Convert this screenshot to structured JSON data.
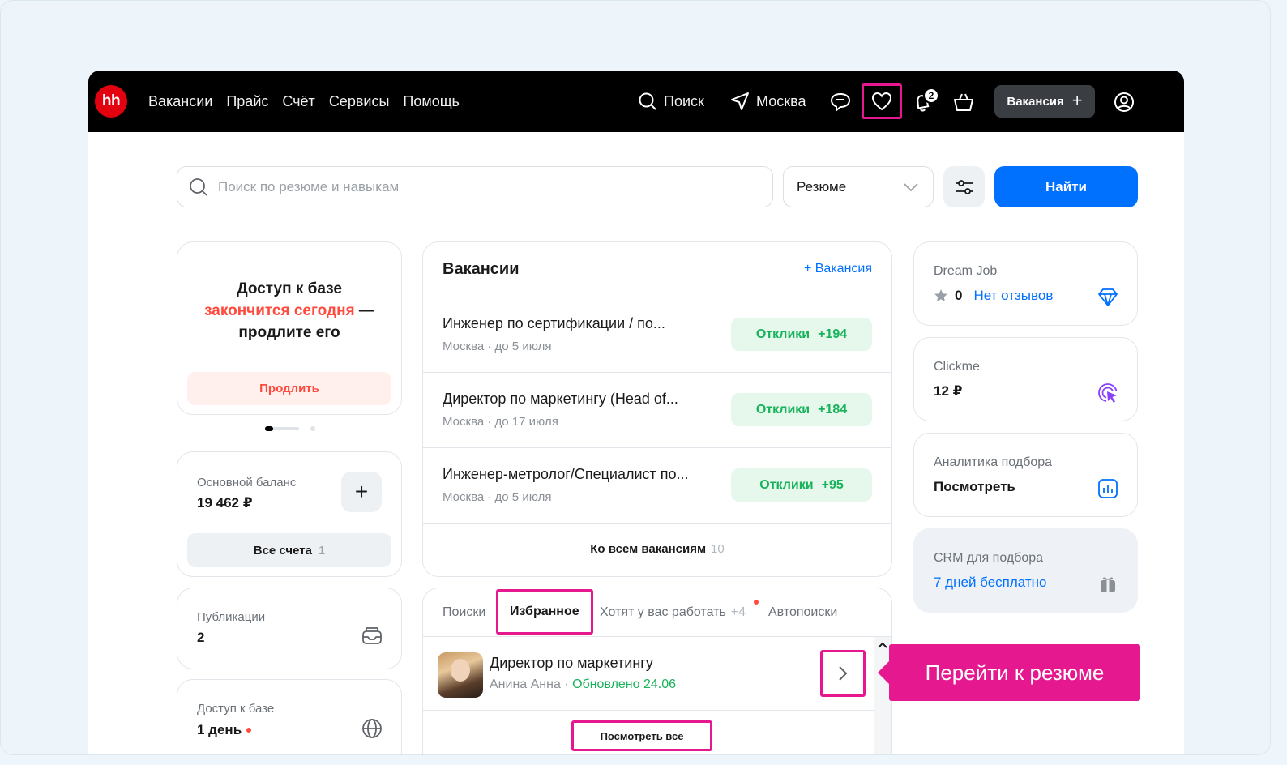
{
  "header": {
    "logo": "hh",
    "nav": [
      "Вакансии",
      "Прайс",
      "Счёт",
      "Сервисы",
      "Помощь"
    ],
    "search_label": "Поиск",
    "city_label": "Москва",
    "notifications_count": "2",
    "vacancy_button": "Вакансия",
    "vacancy_button_plus": "+"
  },
  "search": {
    "placeholder": "Поиск по резюме и навыкам",
    "select_value": "Резюме",
    "find_button": "Найти"
  },
  "promo": {
    "line1": "Доступ к базе",
    "line2_red": "закончится сегодня",
    "line2_rest": " —",
    "line3": "продлите его",
    "button": "Продлить"
  },
  "balance": {
    "label": "Основной баланс",
    "value": "19 462 ₽",
    "plus": "+",
    "accounts_label": "Все счета",
    "accounts_count": "1"
  },
  "publications": {
    "label": "Публикации",
    "value": "2"
  },
  "base_access": {
    "label": "Доступ к базе",
    "value": "1 день"
  },
  "vacancies": {
    "title": "Вакансии",
    "add_label": "+ Вакансия",
    "items": [
      {
        "title": "Инженер по сертификации / по...",
        "sub": "Москва · до 5 июля",
        "resp_label": "Отклики",
        "resp_count": "+194"
      },
      {
        "title": "Директор по маркетингу (Head of...",
        "sub": "Москва · до 17 июля",
        "resp_label": "Отклики",
        "resp_count": "+184"
      },
      {
        "title": "Инженер-метролог/Специалист по...",
        "sub": "Москва · до 5 июля",
        "resp_label": "Отклики",
        "resp_count": "+95"
      }
    ],
    "all_label": "Ко всем вакансиям",
    "all_count": "10"
  },
  "tabs": {
    "items": [
      "Поиски",
      "Избранное",
      "Хотят у вас работать",
      "Автопоиски"
    ],
    "want_count": "+4"
  },
  "favorite": {
    "title": "Директор по маркетингу",
    "name": "Анина Анна",
    "sep": " · ",
    "updated": "Обновлено 24.06",
    "view_all": "Посмотреть все"
  },
  "tooltip": "Перейти к резюме",
  "right": {
    "dreamjob": {
      "label": "Dream Job",
      "rating": "0",
      "reviews": "Нет отзывов"
    },
    "clickme": {
      "label": "Clickme",
      "value": "12 ₽"
    },
    "analytics": {
      "label": "Аналитика подбора",
      "value": "Посмотреть"
    },
    "crm": {
      "label": "CRM для подбора",
      "value": "7 дней бесплатно"
    }
  },
  "colors": {
    "brand_red": "#e3000f",
    "accent_blue": "#0070ff",
    "highlight_pink": "#e6188f",
    "success_green": "#17b35a"
  }
}
